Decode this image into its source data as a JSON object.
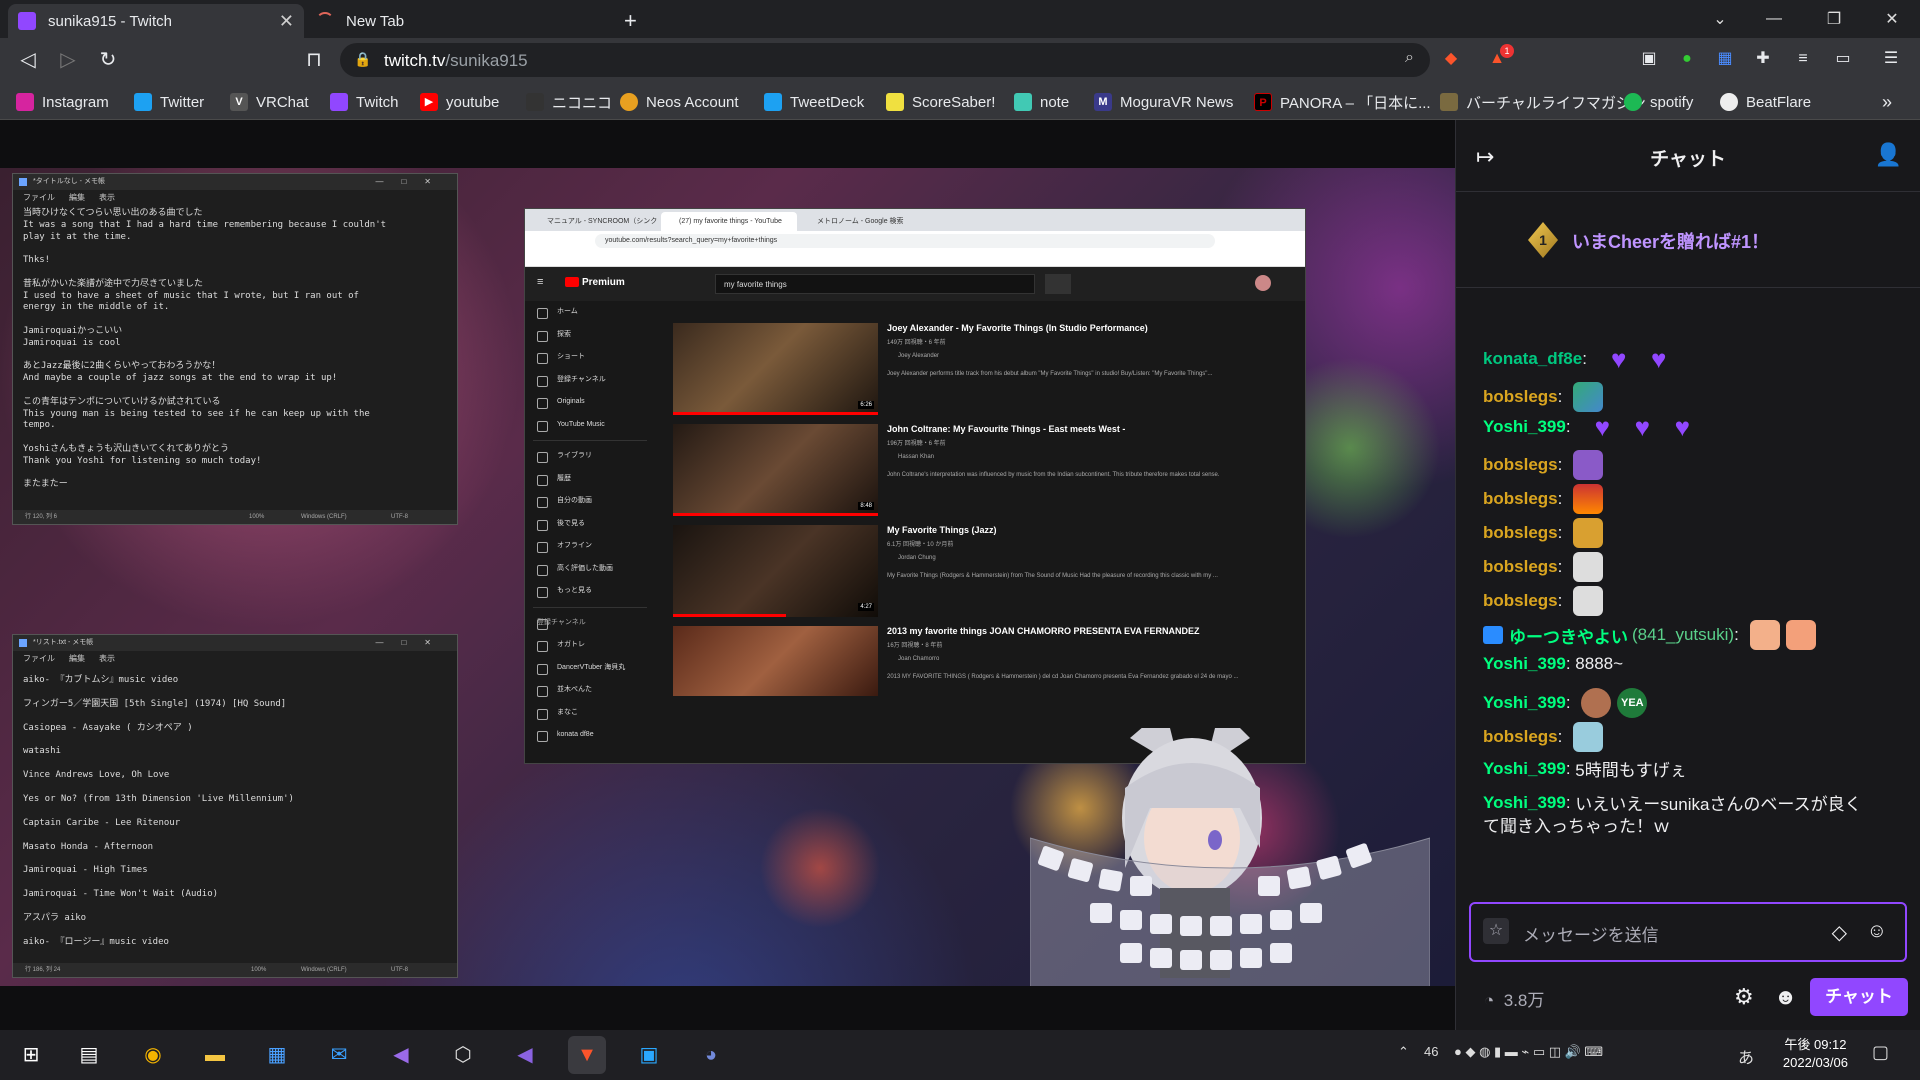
{
  "browser": {
    "tabs": [
      {
        "title": "sunika915 - Twitch",
        "active": true
      },
      {
        "title": "New Tab",
        "active": false
      }
    ],
    "url_host": "twitch.tv",
    "url_path": "/sunika915",
    "bookmarks": [
      "Instagram",
      "Twitter",
      "VRChat",
      "Twitch",
      "youtube",
      "ニコニコ",
      "Neos Account",
      "TweetDeck",
      "ScoreSaber!",
      "note",
      "MoguraVR News",
      "PANORA – 「日本に...",
      "バーチャルライフマガジン",
      "spotify",
      "BeatFlare"
    ],
    "brave_badge": "1"
  },
  "notepad1": {
    "title": "*タイトルなし - メモ帳",
    "menu": [
      "ファイル",
      "編集",
      "表示"
    ],
    "lines": [
      "当時ひけなくてつらい思い出のある曲でした",
      "It was a song that I had a hard time remembering because I couldn't",
      "play it at the time.",
      "",
      "Thks!",
      "",
      "昔私がかいた楽譜が途中で力尽きていました",
      "I used to have a sheet of music that I wrote, but I ran out of",
      "energy in the middle of it.",
      "",
      "Jamiroquaiかっこいい",
      "Jamiroquai is cool",
      "",
      "あとJazz最後に2曲くらいやっておわろうかな！",
      "And maybe a couple of jazz songs at the end to wrap it up!",
      "",
      "この青年はテンポについていけるか試されている",
      "This young man is being tested to see if he can keep up with the",
      "tempo.",
      "",
      "Yoshiさんもきょうも沢山きいてくれてありがとう",
      "Thank you Yoshi for listening so much today!",
      "",
      "またまたー"
    ],
    "status": [
      "行 120, 列 6",
      "100%",
      "Windows (CRLF)",
      "UTF-8"
    ]
  },
  "notepad2": {
    "title": "*リスト.txt - メモ帳",
    "menu": [
      "ファイル",
      "編集",
      "表示"
    ],
    "lines": [
      "aiko- 『カブトムシ』music video",
      "フィンガー5／学園天国 [5th Single] (1974) [HQ Sound]",
      "Casiopea - Asayake ( カシオペア )",
      "watashi",
      "Vince Andrews Love, Oh Love",
      "Yes or No? (from 13th Dimension 'Live Millennium')",
      "Captain Caribe - Lee Ritenour",
      "Masato Honda - Afternoon",
      "Jamiroquai - High Times",
      "Jamiroquai - Time Won't Wait (Audio)",
      "アスパラ aiko",
      "aiko- 『ロージー』music video"
    ],
    "status": [
      "行 186, 列 24",
      "100%",
      "Windows (CRLF)",
      "UTF-8"
    ]
  },
  "youtube": {
    "tabs": [
      "マニュアル - SYNCROOM（シンクル...",
      "(27) my favorite things - YouTube",
      "メトロノーム - Google 検索"
    ],
    "url": "youtube.com/results?search_query=my+favorite+things",
    "search": "my favorite things",
    "logo": "Premium",
    "sidebar": [
      "ホーム",
      "探索",
      "ショート",
      "登録チャンネル",
      "Originals",
      "YouTube Music",
      "ライブラリ",
      "履歴",
      "自分の動画",
      "後で見る",
      "オフライン",
      "高く評価した動画",
      "もっと見る",
      "登録チャンネル",
      "オガトレ",
      "DancerVTuber 海貝丸",
      "並木ぺんた",
      "まなこ",
      "konata df8e"
    ],
    "results": [
      {
        "title": "Joey Alexander - My Favorite Things (In Studio Performance)",
        "meta": "149万 回視聴・6 年前",
        "channel": "Joey Alexander",
        "desc": "Joey Alexander performs title track from his debut album \"My Favorite Things\" in studio! Buy/Listen: \"My Favorite Things\"...",
        "duration": "6:26"
      },
      {
        "title": "John Coltrane: My Favourite Things - East meets West -",
        "meta": "196万 回視聴・6 年前",
        "channel": "Hassan Khan",
        "desc": "John Coltrane's interpretation was influenced by music from the Indian subcontinent. This tribute therefore makes total sense.",
        "duration": "8:48"
      },
      {
        "title": "My Favorite Things (Jazz)",
        "meta": "6.1万 回視聴・10 か月前",
        "channel": "Jordan Chung",
        "desc": "My Favorite Things (Rodgers & Hammerstein) from The Sound of Music Had the pleasure of recording this classic with my ...",
        "duration": "4:27"
      },
      {
        "title": "2013 my favorite things JOAN CHAMORRO PRESENTA EVA FERNANDEZ",
        "meta": "16万 回視聴・8 年前",
        "channel": "Joan Chamorro",
        "desc": "2013 MY FAVORITE THINGS ( Rodgers & Hammerstein ) del cd Joan Chamorro presenta Eva Fernandez grabado el 24 de mayo ...",
        "duration": ""
      }
    ]
  },
  "chat": {
    "title": "チャット",
    "cheer_rank": "1",
    "cheer_text": "いまCheerを贈れば#1！",
    "messages": [
      {
        "user": "konata_df8e",
        "color": "#00c880",
        "text": ""
      },
      {
        "user": "bobslegs",
        "color": "#daa520",
        "text": ""
      },
      {
        "user": "Yoshi_399",
        "color": "#00ff7f",
        "text": ""
      },
      {
        "user": "bobslegs",
        "color": "#daa520",
        "text": ""
      },
      {
        "user": "bobslegs",
        "color": "#daa520",
        "text": ""
      },
      {
        "user": "bobslegs",
        "color": "#daa520",
        "text": ""
      },
      {
        "user": "bobslegs",
        "color": "#daa520",
        "text": ""
      },
      {
        "user": "bobslegs",
        "color": "#daa520",
        "text": ""
      },
      {
        "user": "ゆーつきやよい",
        "color": "#00ff7f",
        "text": "(841_yutsuki)"
      },
      {
        "user": "Yoshi_399",
        "color": "#00ff7f",
        "text": "8888~"
      },
      {
        "user": "Yoshi_399",
        "color": "#00ff7f",
        "text": ""
      },
      {
        "user": "bobslegs",
        "color": "#daa520",
        "text": ""
      },
      {
        "user": "Yoshi_399",
        "color": "#00ff7f",
        "text": "5時間もすげぇ"
      },
      {
        "user": "Yoshi_399",
        "color": "#00ff7f",
        "text": "いえいえーsunikaさんのベースが良く"
      },
      {
        "user": "",
        "color": "#efeff1",
        "text": "て聞き入っちゃった！ｗ"
      }
    ],
    "yea_emote": "YEA",
    "input_placeholder": "メッセージを送信",
    "points": "3.8万",
    "send_label": "チャット"
  },
  "taskbar": {
    "tray_num": "46",
    "ime": "あ",
    "time": "午後 09:12",
    "date": "2022/03/06"
  },
  "colors": {
    "twitch_purple": "#9147ff",
    "chat_bg": "#18181b",
    "chrome_bg": "#35363a"
  }
}
